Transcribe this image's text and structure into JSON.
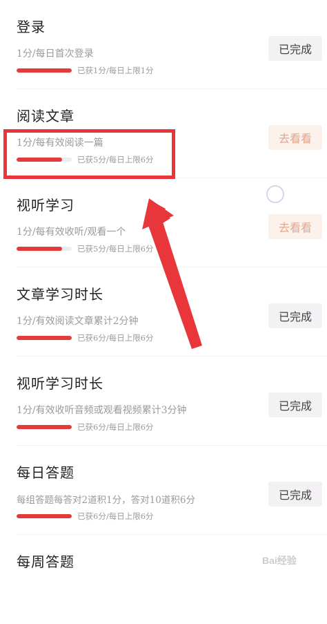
{
  "tasks": [
    {
      "title": "登录",
      "desc": "1分/每日首次登录",
      "progress_text": "已获1分/每日上限1分",
      "progress": 1.0,
      "button": "已完成",
      "state": "done"
    },
    {
      "title": "阅读文章",
      "desc": "1分/每有效阅读一篇",
      "progress_text": "已获5分/每日上限6分",
      "progress": 0.83,
      "button": "去看看",
      "state": "go"
    },
    {
      "title": "视听学习",
      "desc": "1分/每有效收听/观看一个",
      "progress_text": "已获5分/每日上限6分",
      "progress": 0.83,
      "button": "去看看",
      "state": "go"
    },
    {
      "title": "文章学习时长",
      "desc": "1分/有效阅读文章累计2分钟",
      "progress_text": "已获6分/每日上限6分",
      "progress": 1.0,
      "button": "已完成",
      "state": "done"
    },
    {
      "title": "视听学习时长",
      "desc": "1分/有效收听音频或观看视频累计3分钟",
      "progress_text": "已获6分/每日上限6分",
      "progress": 1.0,
      "button": "已完成",
      "state": "done"
    },
    {
      "title": "每日答题",
      "desc": "每组答题每答对2道积1分，答对10道积6分",
      "progress_text": "已获6分/每日上限6分",
      "progress": 1.0,
      "button": "已完成",
      "state": "done"
    },
    {
      "title": "每周答题",
      "desc": "",
      "progress_text": "",
      "progress": null,
      "button": "",
      "state": "partial"
    }
  ],
  "colors": {
    "progress_fill": "#e23b3b",
    "annotation_red": "#e8363a",
    "done_button_bg": "#f3f1f4",
    "go_button_bg": "#fdf1ec",
    "go_button_text": "#e0a890"
  },
  "watermark_text": "Bai经验"
}
